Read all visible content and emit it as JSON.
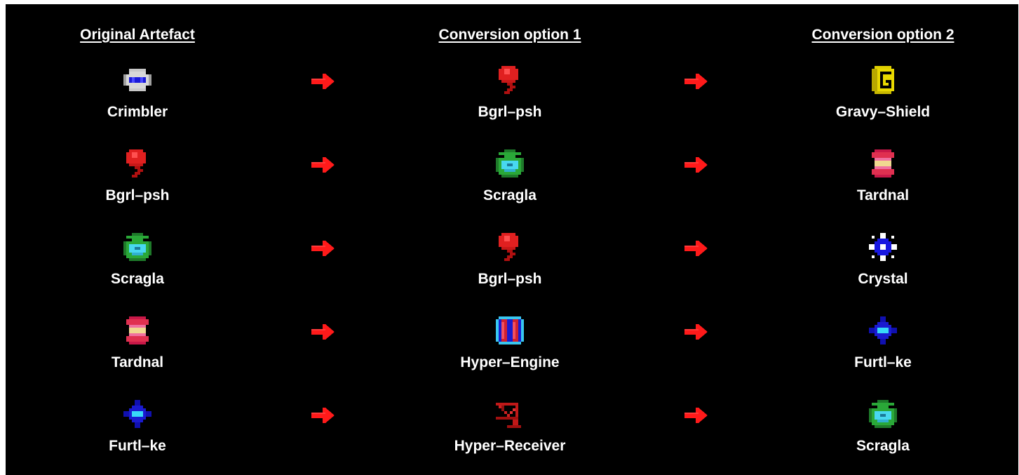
{
  "headers": [
    "Original Artefact",
    "Conversion option 1",
    "Conversion option 2"
  ],
  "colors": {
    "background": "#000000",
    "text": "#ffffff",
    "arrow": "#ff1a1a"
  },
  "rows": [
    {
      "original": {
        "name": "Crimbler",
        "icon": "crimbler-icon"
      },
      "option1": {
        "name": "Bgrl–psh",
        "icon": "bgrl-psh-icon"
      },
      "option2": {
        "name": "Gravy–Shield",
        "icon": "gravy-shield-icon"
      }
    },
    {
      "original": {
        "name": "Bgrl–psh",
        "icon": "bgrl-psh-icon"
      },
      "option1": {
        "name": "Scragla",
        "icon": "scragla-icon"
      },
      "option2": {
        "name": "Tardnal",
        "icon": "tardnal-icon"
      }
    },
    {
      "original": {
        "name": "Scragla",
        "icon": "scragla-icon"
      },
      "option1": {
        "name": "Bgrl–psh",
        "icon": "bgrl-psh-icon"
      },
      "option2": {
        "name": "Crystal",
        "icon": "crystal-icon"
      }
    },
    {
      "original": {
        "name": "Tardnal",
        "icon": "tardnal-icon"
      },
      "option1": {
        "name": "Hyper–Engine",
        "icon": "hyper-engine-icon"
      },
      "option2": {
        "name": "Furtl–ke",
        "icon": "furtl-ke-icon"
      }
    },
    {
      "original": {
        "name": "Furtl–ke",
        "icon": "furtl-ke-icon"
      },
      "option1": {
        "name": "Hyper–Receiver",
        "icon": "hyper-receiver-icon"
      },
      "option2": {
        "name": "Scragla",
        "icon": "scragla-icon"
      }
    }
  ]
}
